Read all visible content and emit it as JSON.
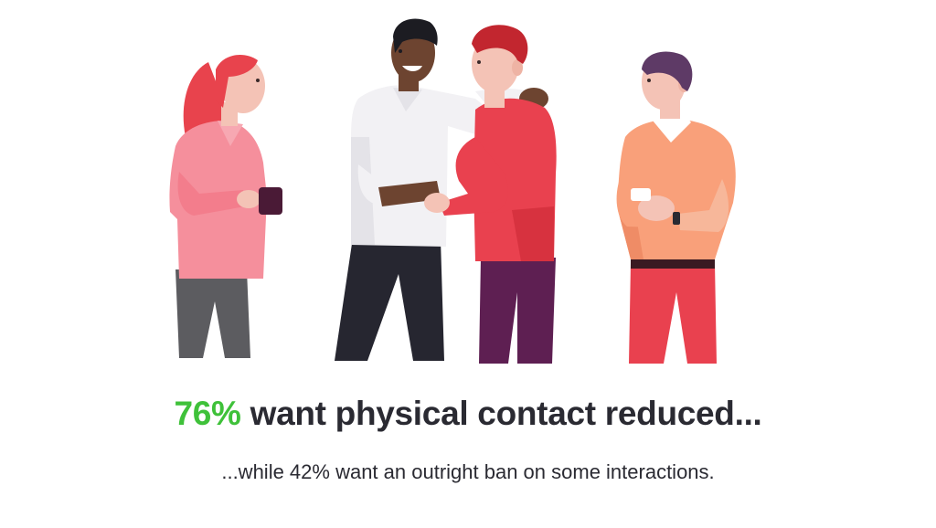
{
  "headline": {
    "accent_text": "76%",
    "rest_text": "want physical contact reduced..."
  },
  "subline": {
    "text": "...while 42% want an outright ban on some interactions."
  },
  "colors": {
    "accent_green": "#3fc13a",
    "text_dark": "#2a2a32"
  }
}
